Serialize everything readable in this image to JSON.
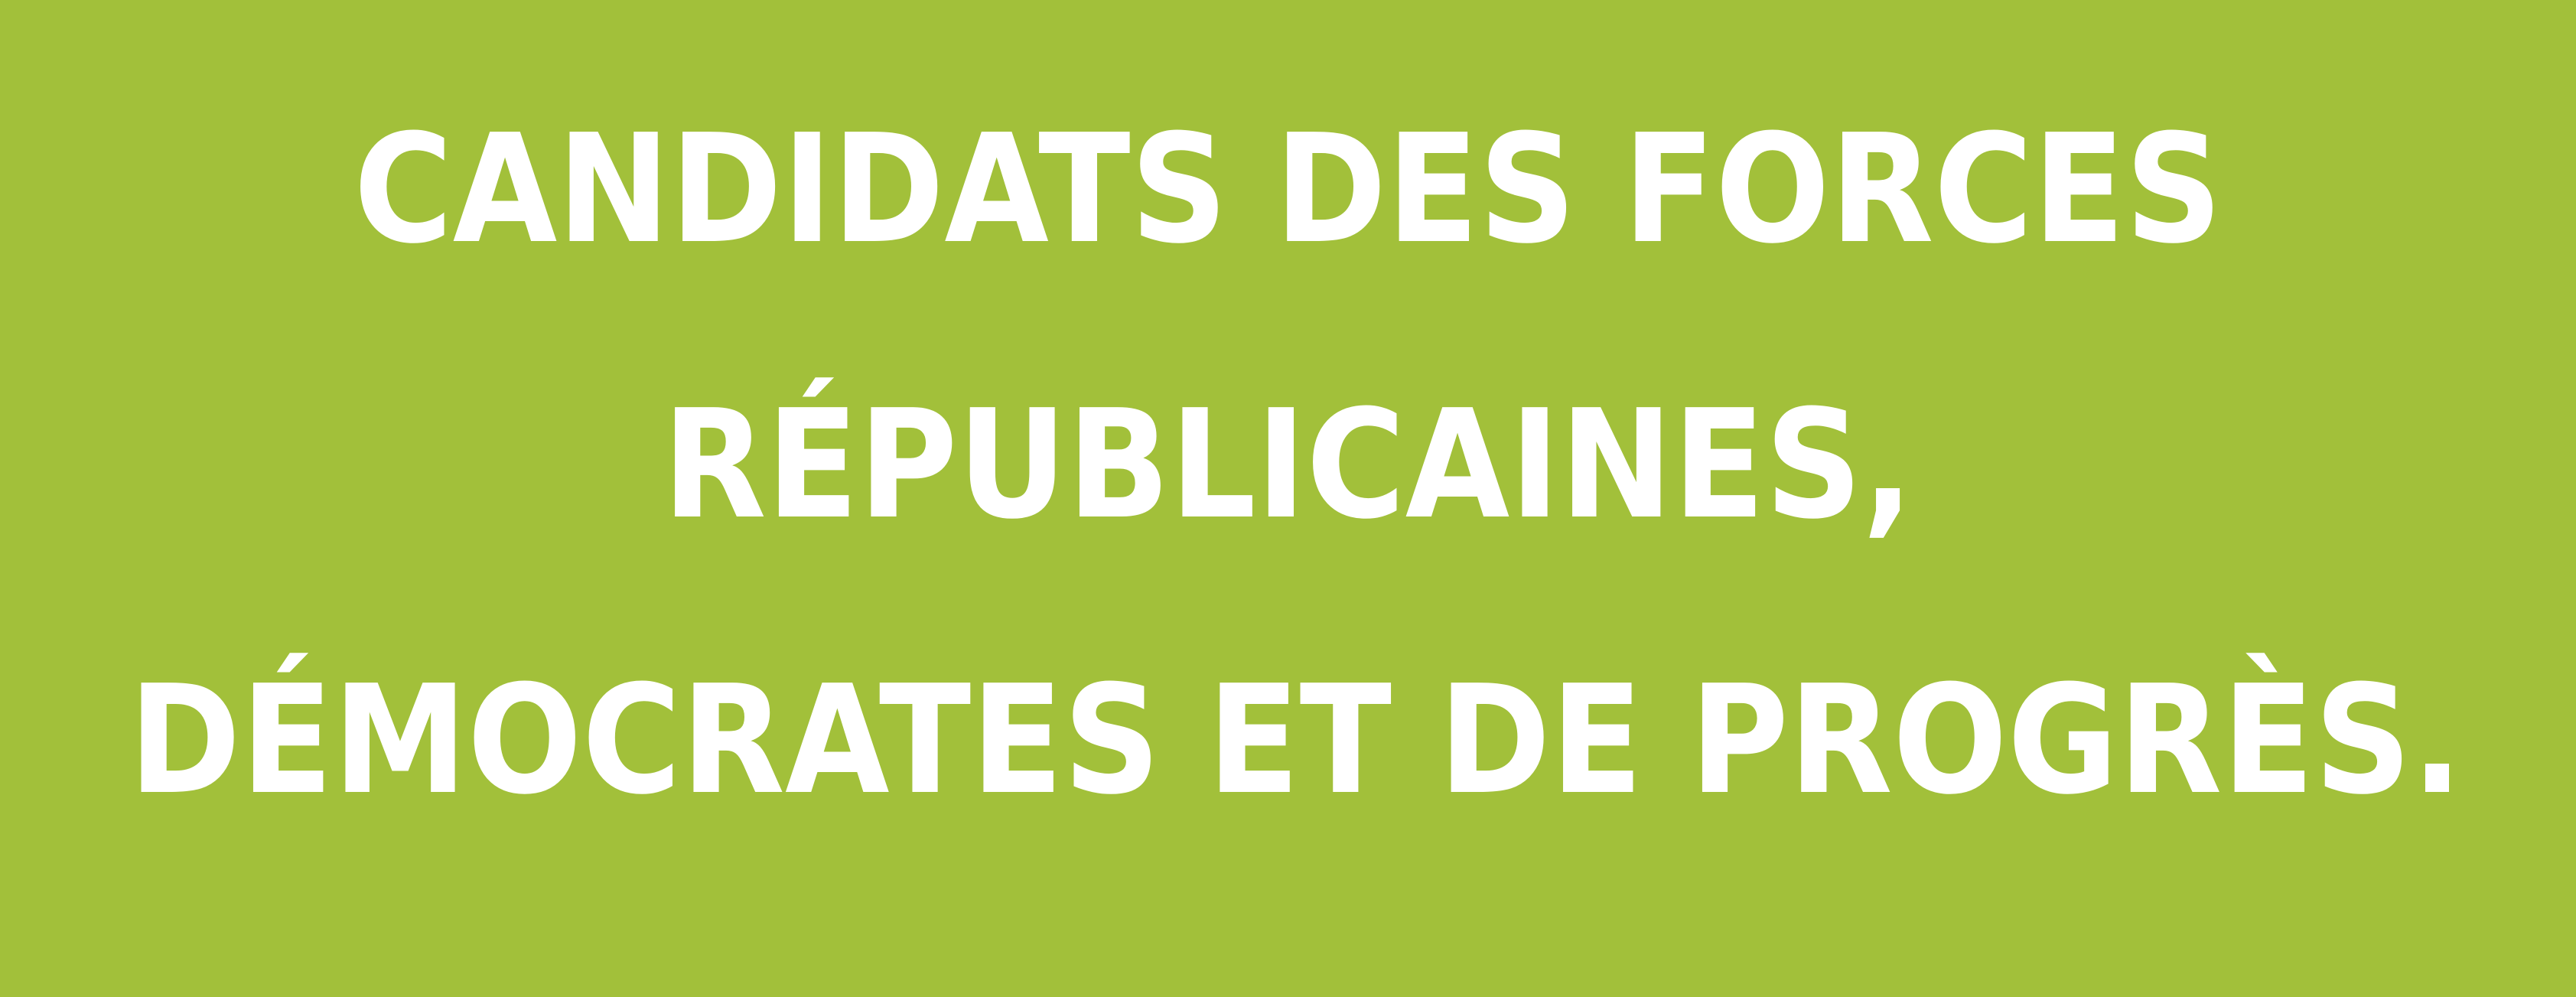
{
  "banner": {
    "background_color": "#a2c03a",
    "text_color": "#ffffff",
    "lines": [
      "CANDIDATS DES FORCES",
      "RÉPUBLICAINES,",
      "DÉMOCRATES ET DE PROGRÈS."
    ]
  }
}
